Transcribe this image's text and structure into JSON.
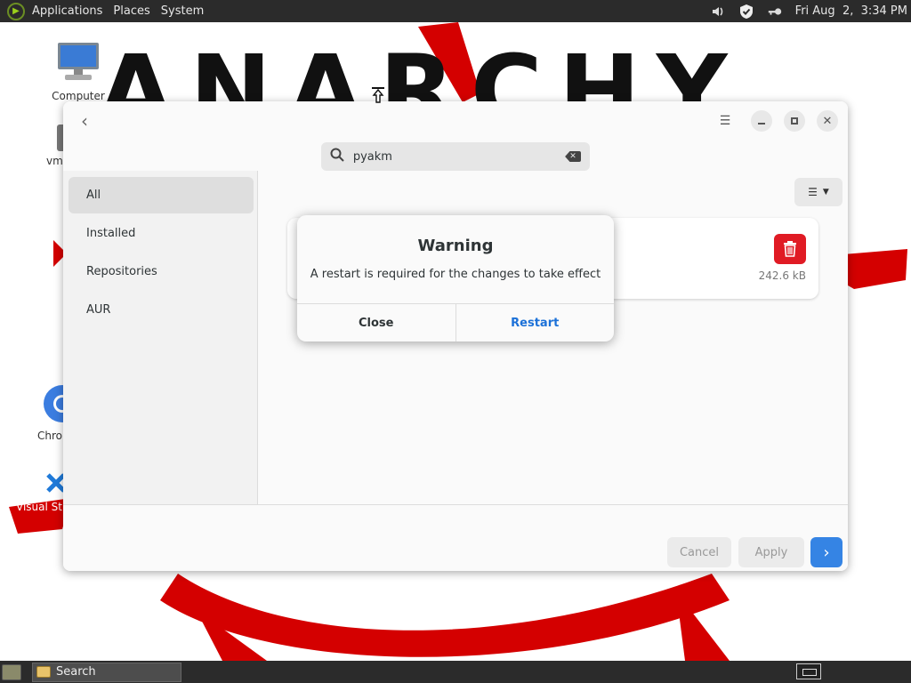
{
  "top_panel": {
    "menus": [
      "Applications",
      "Places",
      "System"
    ],
    "clock": "Fri Aug  2,  3:34 PM",
    "icons": [
      "volume-icon",
      "shield-check-icon",
      "key-icon"
    ]
  },
  "wallpaper": {
    "text": "ANARCHY",
    "color": "#d40000"
  },
  "desktop": {
    "icons": [
      {
        "label": "Computer",
        "icon": "computer-icon"
      },
      {
        "label": "vm",
        "icon": "vm-icon"
      },
      {
        "label": "Chro",
        "icon": "chromium-icon"
      },
      {
        "label": "Visual St",
        "icon": "vscode-icon"
      }
    ]
  },
  "window": {
    "search": {
      "value": "pyakm"
    },
    "sidebar": {
      "items": [
        {
          "label": "All",
          "active": true
        },
        {
          "label": "Installed",
          "active": false
        },
        {
          "label": "Repositories",
          "active": false
        },
        {
          "label": "AUR",
          "active": false
        }
      ]
    },
    "package_card": {
      "size": "242.6 kB"
    },
    "footer": {
      "cancel_label": "Cancel",
      "apply_label": "Apply",
      "next_label": "›"
    }
  },
  "dialog": {
    "title": "Warning",
    "message": "A restart is required for the changes to take effect",
    "close_label": "Close",
    "restart_label": "Restart"
  },
  "bottom_panel": {
    "task_label": "Search"
  },
  "colors": {
    "accent": "#3584e4",
    "destructive": "#e01b24",
    "link": "#1c71d8"
  }
}
